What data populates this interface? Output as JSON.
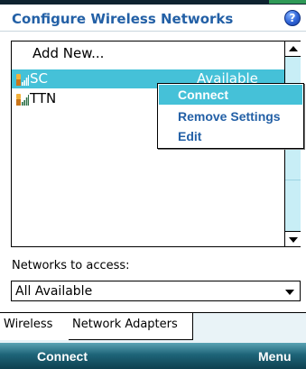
{
  "header": {
    "title": "Configure Wireless Networks",
    "help_icon": "?"
  },
  "network_list": {
    "add_new_label": "Add New...",
    "items": [
      {
        "name": "SC",
        "status": "Available",
        "selected": true,
        "icon": "wifi-signal-icon"
      },
      {
        "name": "TTN",
        "status": "",
        "selected": false,
        "icon": "wifi-signal-icon"
      }
    ]
  },
  "context_menu": {
    "items": [
      "Connect",
      "Remove Settings",
      "Edit"
    ]
  },
  "networks_to_access": {
    "label": "Networks to access:",
    "value": "All Available"
  },
  "tabs": [
    {
      "label": "Wireless",
      "active": true
    },
    {
      "label": "Network Adapters",
      "active": false
    }
  ],
  "softkeys": {
    "left": "Connect",
    "right": "Menu"
  },
  "colors": {
    "title": "#2360a6",
    "selection": "#45c1d8",
    "softkey_bar": "#1e6478"
  }
}
